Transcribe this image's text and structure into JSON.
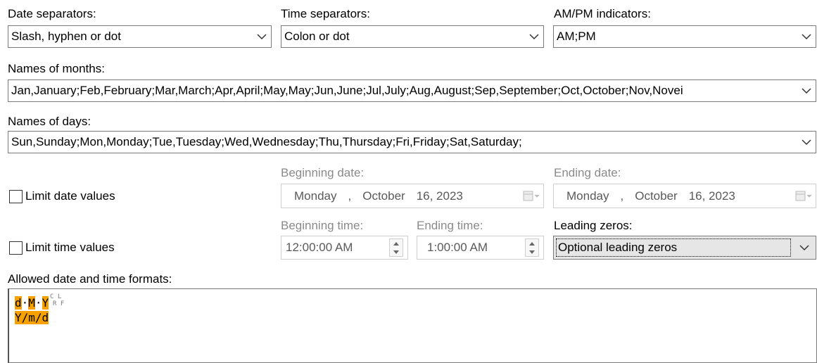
{
  "date_separators": {
    "label": "Date separators:",
    "value": "Slash, hyphen or dot"
  },
  "time_separators": {
    "label": "Time separators:",
    "value": "Colon or dot"
  },
  "ampm": {
    "label": "AM/PM indicators:",
    "value": "AM;PM"
  },
  "months": {
    "label": "Names of months:",
    "value": "Jan,January;Feb,February;Mar,March;Apr,April;May,May;Jun,June;Jul,July;Aug,August;Sep,September;Oct,October;Nov,Novei"
  },
  "days": {
    "label": "Names of days:",
    "value": "Sun,Sunday;Mon,Monday;Tue,Tuesday;Wed,Wednesday;Thu,Thursday;Fri,Friday;Sat,Saturday;"
  },
  "limit_date": {
    "label": "Limit date values",
    "checked": false
  },
  "beginning_date": {
    "label": "Beginning date:",
    "weekday": "Monday",
    "comma": ",",
    "month": "October",
    "day_year": "16, 2023"
  },
  "ending_date": {
    "label": "Ending date:",
    "weekday": "Monday",
    "comma": ",",
    "month": "October",
    "day_year": "16, 2023"
  },
  "limit_time": {
    "label": "Limit time values",
    "checked": false
  },
  "beginning_time": {
    "label": "Beginning time:",
    "value": "12:00:00 AM"
  },
  "ending_time": {
    "label": "Ending time:",
    "value": "1:00:00 AM"
  },
  "leading_zeros": {
    "label": "Leading zeros:",
    "value": "Optional leading zeros"
  },
  "formats": {
    "label": "Allowed date and time formats:",
    "line1": {
      "c1": "d",
      "s1": "·",
      "c2": "M",
      "s2": "·",
      "c3": "Y",
      "sup_top": "C L",
      "sup_bottom": "R F"
    },
    "line2": "Y/m/d"
  },
  "colors": {
    "highlight": "#f7a100",
    "disabled_text": "#8a8a8a"
  },
  "icons": {
    "dropdown": "chevron-down-icon",
    "calendar": "calendar-icon",
    "spinner": "spinner-icon"
  }
}
